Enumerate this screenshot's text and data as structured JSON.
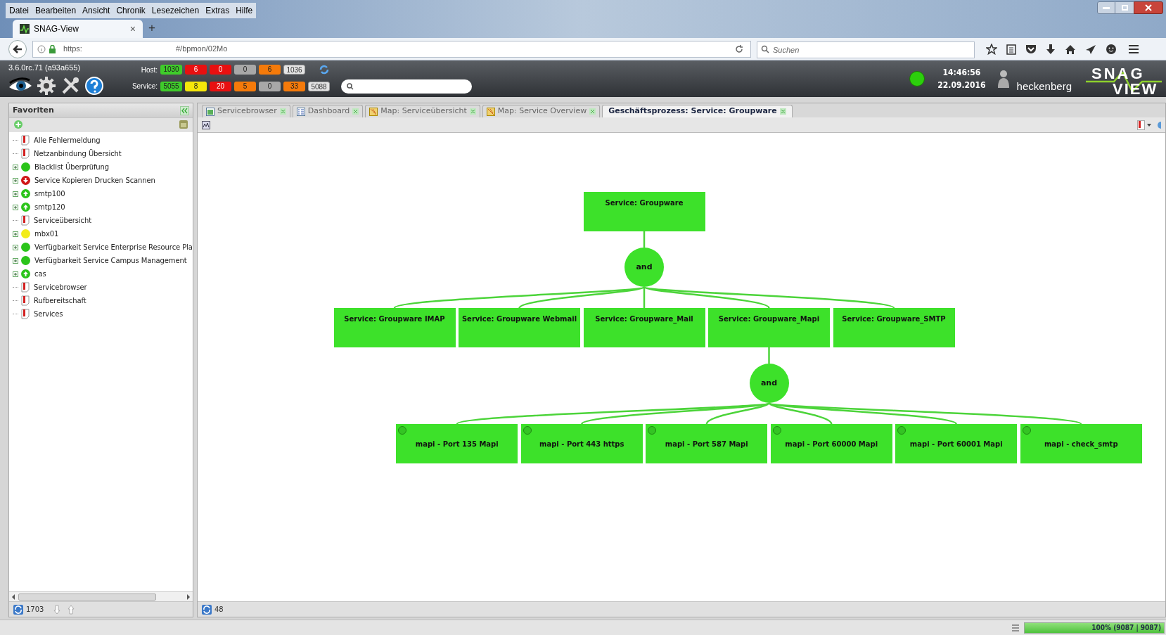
{
  "browser": {
    "menu": [
      "Datei",
      "Bearbeiten",
      "Ansicht",
      "Chronik",
      "Lesezeichen",
      "Extras",
      "Hilfe"
    ],
    "tab": {
      "title": "SNAG-View",
      "close": "×",
      "new": "+"
    },
    "url": {
      "scheme": "https:",
      "path": "#/bpmon/02Mo"
    },
    "search": {
      "placeholder": "Suchen"
    }
  },
  "header": {
    "version": "3.6.0rc.71 (a93a655)",
    "host": {
      "label": "Host:",
      "counts": [
        {
          "value": "1030",
          "color": "#3fcc2a"
        },
        {
          "value": "6",
          "color": "#e81010"
        },
        {
          "value": "0",
          "color": "#e81010"
        },
        {
          "value": "0",
          "color": "#a8a8a8"
        },
        {
          "value": "6",
          "color": "#f57a0a"
        },
        {
          "value": "1036",
          "color": "#e4e4e4"
        }
      ]
    },
    "service": {
      "label": "Service:",
      "counts": [
        {
          "value": "5055",
          "color": "#3fcc2a"
        },
        {
          "value": "8",
          "color": "#f5e60a"
        },
        {
          "value": "20",
          "color": "#e81010"
        },
        {
          "value": "5",
          "color": "#f57a0a"
        },
        {
          "value": "0",
          "color": "#a8a8a8"
        },
        {
          "value": "33",
          "color": "#f57a0a"
        },
        {
          "value": "5088",
          "color": "#e4e4e4"
        }
      ]
    },
    "time": "14:46:56",
    "date": "22.09.2016",
    "user": "heckenberg",
    "logo": [
      "SNAG",
      "VIEW"
    ]
  },
  "sidebar": {
    "title": "Favoriten",
    "items": [
      {
        "label": "Alle Fehlermeldung",
        "kind": "report",
        "expandable": false
      },
      {
        "label": "Netzanbindung Übersicht",
        "kind": "report",
        "expandable": false
      },
      {
        "label": "Blacklist Überprüfung",
        "kind": "dot",
        "color": "#2bc41a",
        "expandable": true
      },
      {
        "label": "Service Kopieren Drucken Scannen",
        "kind": "down",
        "color": "#d01818",
        "expandable": true
      },
      {
        "label": "smtp100",
        "kind": "up",
        "color": "#2bc41a",
        "expandable": true
      },
      {
        "label": "smtp120",
        "kind": "up",
        "color": "#2bc41a",
        "expandable": true
      },
      {
        "label": "Serviceübersicht",
        "kind": "report",
        "expandable": false
      },
      {
        "label": "mbx01",
        "kind": "dot",
        "color": "#f2ec1a",
        "expandable": true
      },
      {
        "label": "Verfügbarkeit Service Enterprise Resource Pla",
        "kind": "dot",
        "color": "#2bc41a",
        "expandable": true
      },
      {
        "label": "Verfügbarkeit Service Campus Management",
        "kind": "dot",
        "color": "#2bc41a",
        "expandable": true
      },
      {
        "label": "cas",
        "kind": "up",
        "color": "#2bc41a",
        "expandable": true
      },
      {
        "label": "Servicebrowser",
        "kind": "report",
        "expandable": false
      },
      {
        "label": "Rufbereitschaft",
        "kind": "report",
        "expandable": false
      },
      {
        "label": "Services",
        "kind": "report",
        "expandable": false
      }
    ],
    "footer_count": "1703"
  },
  "tabs": [
    {
      "label": "Servicebrowser",
      "kind": "table",
      "selected": false
    },
    {
      "label": "Dashboard",
      "kind": "list",
      "selected": false
    },
    {
      "label": "Map: Serviceübersicht",
      "kind": "map",
      "selected": false
    },
    {
      "label": "Map: Service Overview",
      "kind": "map",
      "selected": false
    },
    {
      "label": "Geschäftsprozess: Service: Groupware",
      "kind": "none",
      "selected": true
    }
  ],
  "diagram": {
    "root": {
      "label": "Service: Groupware",
      "kind": "service",
      "gate": "and",
      "children": [
        {
          "label": "Service: Groupware IMAP",
          "kind": "service"
        },
        {
          "label": "Service: Groupware Webmail",
          "kind": "service"
        },
        {
          "label": "Service: Groupware_Mail",
          "kind": "service"
        },
        {
          "label": "Service: Groupware_Mapi",
          "kind": "service",
          "gate": "and",
          "children": [
            {
              "label": "mapi - Port 135 Mapi",
              "kind": "check"
            },
            {
              "label": "mapi - Port 443 https",
              "kind": "check"
            },
            {
              "label": "mapi - Port 587 Mapi",
              "kind": "check"
            },
            {
              "label": "mapi - Port 60000 Mapi",
              "kind": "check"
            },
            {
              "label": "mapi - Port 60001 Mapi",
              "kind": "check"
            },
            {
              "label": "mapi - check_smtp",
              "kind": "check"
            }
          ]
        },
        {
          "label": "Service: Groupware_SMTP",
          "kind": "service"
        }
      ]
    }
  },
  "main_footer_count": "48",
  "status_bar": {
    "progress": {
      "text": "100% (9087 | 9087)",
      "level": 1
    }
  }
}
